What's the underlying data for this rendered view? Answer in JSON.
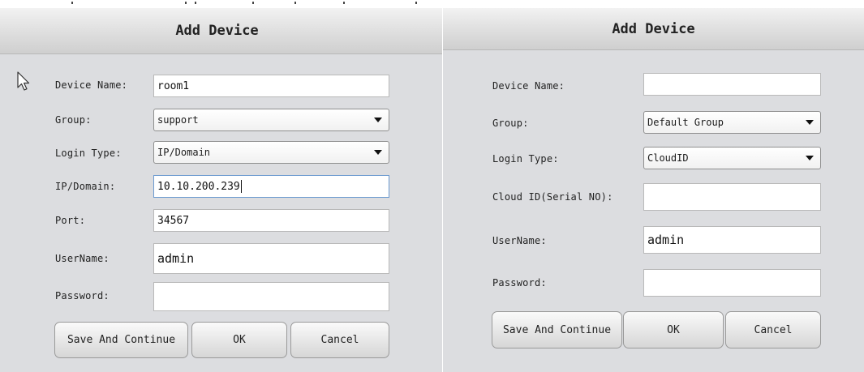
{
  "left_dialog": {
    "title": "Add Device",
    "device_name": {
      "label": "Device Name:",
      "value": "room1"
    },
    "group": {
      "label": "Group:",
      "value": "support"
    },
    "login_type": {
      "label": "Login Type:",
      "value": "IP/Domain"
    },
    "ip_domain": {
      "label": "IP/Domain:",
      "value": "10.10.200.239"
    },
    "port": {
      "label": "Port:",
      "value": "34567"
    },
    "username": {
      "label": "UserName:",
      "value": "admin"
    },
    "password": {
      "label": "Password:",
      "value": ""
    },
    "buttons": {
      "save_continue": "Save And Continue",
      "ok": "OK",
      "cancel": "Cancel"
    }
  },
  "right_dialog": {
    "title": "Add Device",
    "device_name": {
      "label": "Device Name:",
      "value": ""
    },
    "group": {
      "label": "Group:",
      "value": "Default Group"
    },
    "login_type": {
      "label": "Login Type:",
      "value": "CloudID"
    },
    "cloud_id": {
      "label": "Cloud ID(Serial NO):",
      "value": ""
    },
    "username": {
      "label": "UserName:",
      "value": "admin"
    },
    "password": {
      "label": "Password:",
      "value": ""
    },
    "buttons": {
      "save_continue": "Save And Continue",
      "ok": "OK",
      "cancel": "Cancel"
    }
  },
  "icons": {
    "cursor": "mouse-pointer-icon",
    "dropdown": "triangle-down-icon"
  }
}
